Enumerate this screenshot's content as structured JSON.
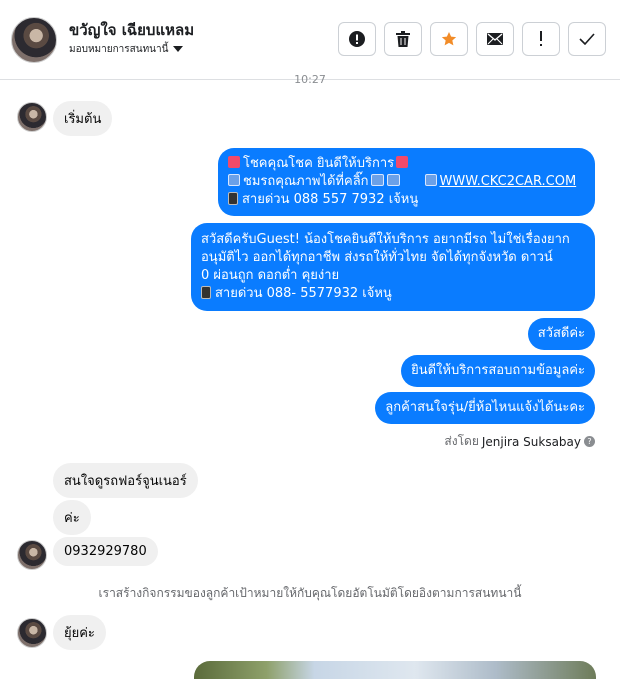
{
  "header": {
    "contact_name": "ขวัญใจ เฉียบแหลม",
    "assign_label": "มอบหมายการสนทนานี้",
    "actions": [
      {
        "name": "report-spam",
        "icon": "exclamation-circle-icon"
      },
      {
        "name": "delete",
        "icon": "trash-icon"
      },
      {
        "name": "star",
        "icon": "star-icon"
      },
      {
        "name": "mark-unread",
        "icon": "envelope-icon"
      },
      {
        "name": "follow-up",
        "icon": "exclamation-icon"
      },
      {
        "name": "mark-done",
        "icon": "check-icon"
      }
    ]
  },
  "timestamp": "10:27",
  "messages": {
    "in_start": "เริ่มต้น",
    "out1": {
      "line1": "โชคคุณโชค ยินดีให้บริการ",
      "line2_text": "ชมรถคุณภาพได้ที่คลิ๊ก",
      "line2_link": "WWW.CKC2CAR.COM",
      "line3": "สายด่วน 088 557 7932 เจ้หนู"
    },
    "out2": {
      "line1": "สวัสดีครับGuest! น้องโชคยินดีให้บริการ อยากมีรถ ไม่ใช่เรื่องยาก",
      "line2": "อนุมัติไว ออกได้ทุกอาชีพ ส่งรถให้ทั่วไทย จัดได้ทุกจังหวัด ดาวน์",
      "line3": "0  ผ่อนถูก ดอกต่ำ คุยง่าย",
      "line4": "สายด่วน 088- 5577932 เจ้หนู"
    },
    "out3": "สวัสดีค่ะ",
    "out4": "ยินดีให้บริการสอบถามข้อมูลค่ะ",
    "out5": "ลูกค้าสนใจรุ่น/ยี่ห้อไหนแจ้งได้นะคะ",
    "sent_by_label": "ส่งโดย",
    "sent_by_name": "Jenjira Suksabay",
    "in2": "สนใจดูรถฟอร์จูนเนอร์",
    "in3": "ค่ะ",
    "in4": "0932929780",
    "system_note": "เราสร้างกิจกรรมของลูกค้าเป้าหมายให้กับคุณโดยอัตโนมัติโดยอิงตามการสนทนานี้",
    "in5": "ยุ้ยค่ะ"
  },
  "colors": {
    "outgoing": "#0a7cff",
    "incoming": "#f0f0f0",
    "star": "#f28c28"
  }
}
